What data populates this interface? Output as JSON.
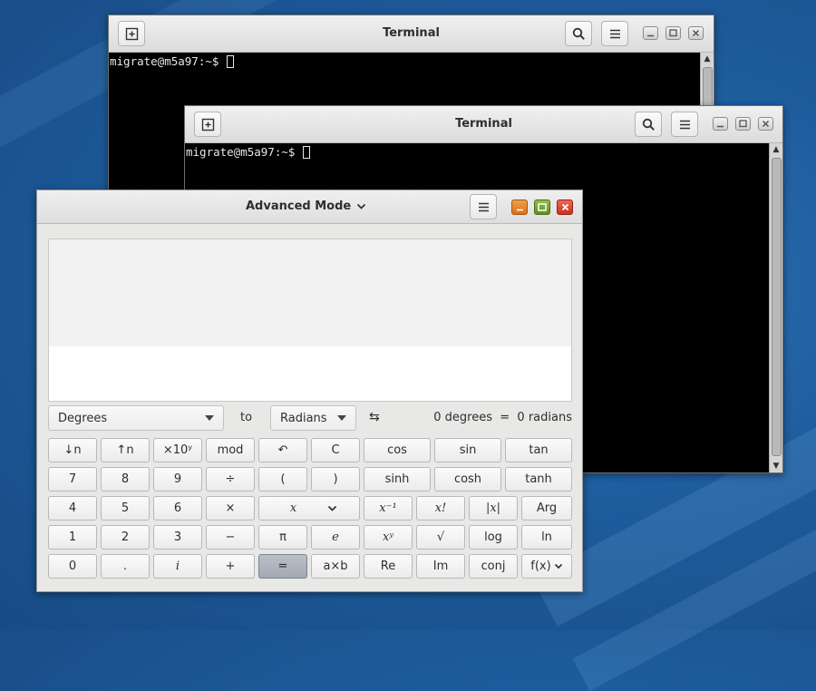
{
  "colors": {
    "desktop": "#1e5c9d",
    "terminal_bg": "#000000",
    "calc_bg": "#e8e8e7",
    "min_btn": "#e07a1e",
    "max_btn": "#6a9a2a",
    "close_btn": "#d43a2a"
  },
  "terminal1": {
    "title": "Terminal",
    "prompt": "migrate@m5a97:~$",
    "icons": [
      "new-tab-icon",
      "search-icon",
      "hamburger-menu-icon",
      "minimize-icon",
      "maximize-icon",
      "close-icon"
    ]
  },
  "terminal2": {
    "title": "Terminal",
    "prompt": "migrate@m5a97:~$"
  },
  "calculator": {
    "mode_title": "Advanced Mode",
    "display_text": "",
    "converter": {
      "from_unit": "Degrees",
      "to_label": "to",
      "to_unit": "Radians",
      "swap_icon": "⇆",
      "result": "0 degrees  =  0 radians"
    },
    "keys": {
      "r0": [
        "↓n",
        "↑n",
        "×10ʸ",
        "mod",
        "↶",
        "C",
        "cos",
        "sin",
        "tan"
      ],
      "r1": [
        "7",
        "8",
        "9",
        "÷",
        "(",
        ")",
        "sinh",
        "cosh",
        "tanh"
      ],
      "r2": [
        "4",
        "5",
        "6",
        "×",
        "x",
        "x⁻¹",
        "x!",
        "|x|",
        "Arg"
      ],
      "r3": [
        "1",
        "2",
        "3",
        "−",
        "π",
        "e",
        "xʸ",
        "√",
        "log",
        "ln"
      ],
      "r4": [
        "0",
        ".",
        "i",
        "+",
        "=",
        "a×b",
        "Re",
        "Im",
        "conj",
        "f(x)"
      ]
    }
  }
}
